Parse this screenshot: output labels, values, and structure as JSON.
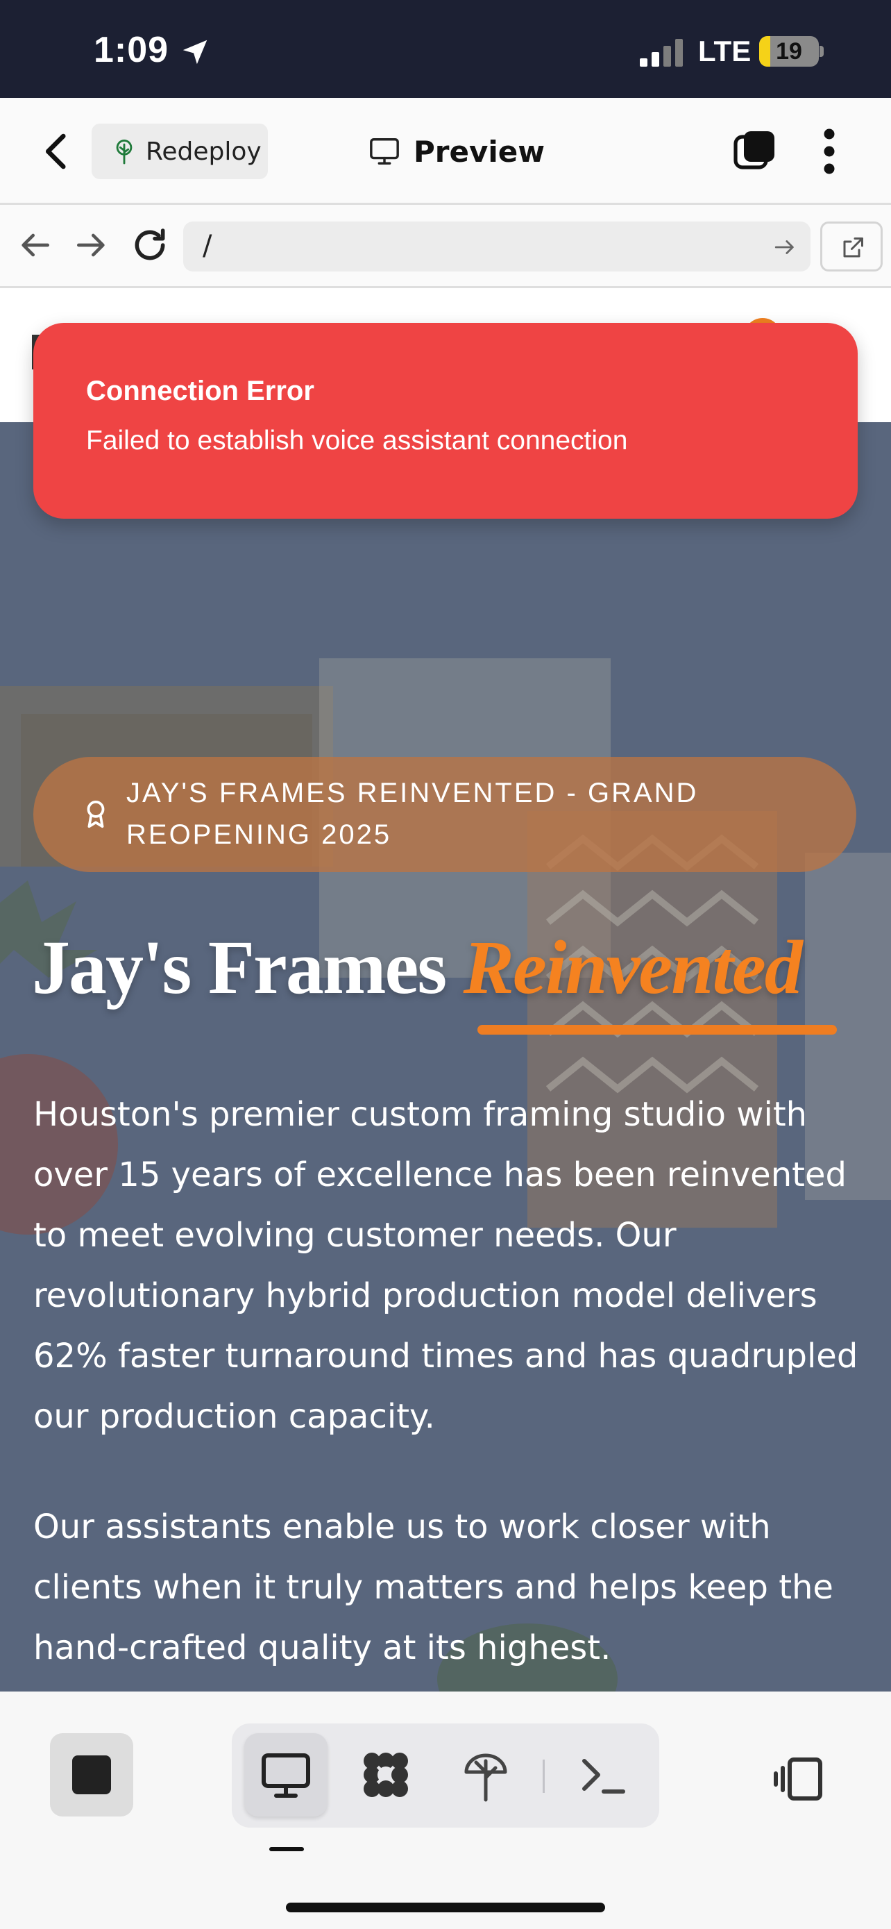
{
  "status_bar": {
    "time": "1:09",
    "network": "LTE",
    "battery": "19",
    "battery_level": 0.19,
    "icons": [
      "location-arrow-icon",
      "signal-icon",
      "battery-icon"
    ]
  },
  "header": {
    "redeploy_label": "Redeploy",
    "preview_label": "Preview",
    "icons": [
      "chevron-left-icon",
      "tree-icon",
      "monitor-icon",
      "tabs-icon",
      "more-vertical-icon"
    ]
  },
  "url_bar": {
    "value": "/",
    "icons": [
      "arrow-left-icon",
      "arrow-right-icon",
      "refresh-icon",
      "arrow-go-icon",
      "external-link-icon"
    ]
  },
  "toast": {
    "title": "Connection Error",
    "message": "Failed to establish voice assistant connection",
    "color": "#ef4444"
  },
  "hero": {
    "badge": "JAY'S FRAMES REINVENTED - GRAND REOPENING 2025",
    "title_main": "Jay's Frames ",
    "title_accent": "Reinvented",
    "paragraph_1": "Houston's premier custom framing studio with over 15 years of excellence has been reinvented to meet evolving customer needs. Our revolutionary hybrid production model delivers 62% faster turnaround times and has quadrupled our production capacity.",
    "paragraph_2": "Our assistants enable us to work closer with clients when it truly matters and helps keep the hand-crafted quality at its highest.",
    "accent_color": "#f58220",
    "badge_color": "#bb7544",
    "fab_color": "#1f3a60"
  },
  "toolbar": {
    "icons": [
      "stop-icon",
      "monitor-icon",
      "grid-icon",
      "tree-icon",
      "terminal-icon",
      "panel-toggle-icon"
    ],
    "active_tab": "monitor"
  }
}
